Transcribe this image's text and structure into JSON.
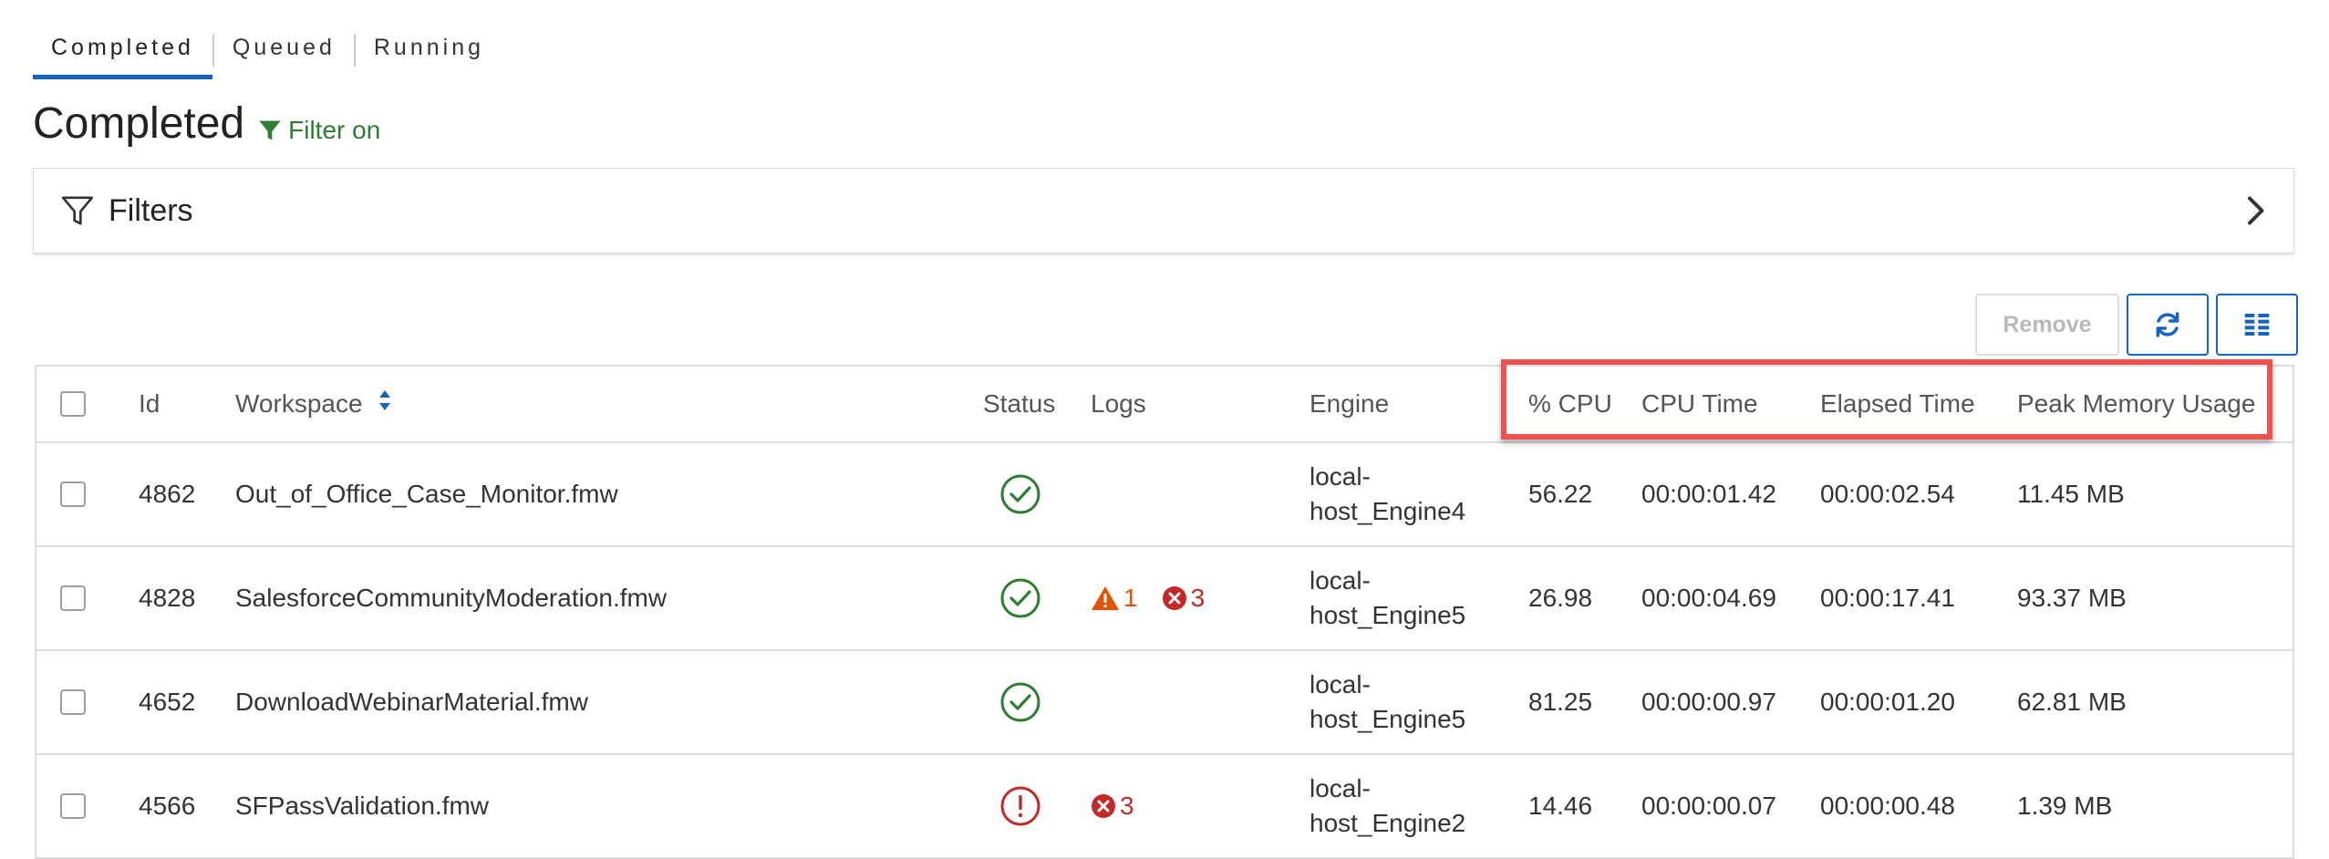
{
  "tabs": [
    {
      "label": "Completed",
      "active": true
    },
    {
      "label": "Queued",
      "active": false
    },
    {
      "label": "Running",
      "active": false
    }
  ],
  "page": {
    "title": "Completed",
    "filter_status": "Filter on"
  },
  "filters": {
    "label": "Filters"
  },
  "toolbar": {
    "remove_label": "Remove"
  },
  "table": {
    "headers": {
      "id": "Id",
      "workspace": "Workspace",
      "status": "Status",
      "logs": "Logs",
      "engine": "Engine",
      "cpu_percent": "% CPU",
      "cpu_time": "CPU Time",
      "elapsed_time": "Elapsed Time",
      "peak_memory": "Peak Memory Usage"
    },
    "rows": [
      {
        "id": "4862",
        "workspace": "Out_of_Office_Case_Monitor.fmw",
        "status": "success",
        "warnings": "",
        "errors": "",
        "engine_line1": "local-",
        "engine_line2": "host_Engine4",
        "cpu_percent": "56.22",
        "cpu_time": "00:00:01.42",
        "elapsed_time": "00:00:02.54",
        "peak_memory": "11.45 MB"
      },
      {
        "id": "4828",
        "workspace": "SalesforceCommunityModeration.fmw",
        "status": "success",
        "warnings": "1",
        "errors": "3",
        "engine_line1": "local-",
        "engine_line2": "host_Engine5",
        "cpu_percent": "26.98",
        "cpu_time": "00:00:04.69",
        "elapsed_time": "00:00:17.41",
        "peak_memory": "93.37 MB"
      },
      {
        "id": "4652",
        "workspace": "DownloadWebinarMaterial.fmw",
        "status": "success",
        "warnings": "",
        "errors": "",
        "engine_line1": "local-",
        "engine_line2": "host_Engine5",
        "cpu_percent": "81.25",
        "cpu_time": "00:00:00.97",
        "elapsed_time": "00:00:01.20",
        "peak_memory": "62.81 MB"
      },
      {
        "id": "4566",
        "workspace": "SFPassValidation.fmw",
        "status": "failure",
        "warnings": "",
        "errors": "3",
        "engine_line1": "local-",
        "engine_line2": "host_Engine2",
        "cpu_percent": "14.46",
        "cpu_time": "00:00:00.07",
        "elapsed_time": "00:00:00.48",
        "peak_memory": "1.39 MB"
      }
    ]
  },
  "colors": {
    "accent": "#1565c0",
    "success": "#2e7d32",
    "error": "#c62828",
    "warning": "#e65100",
    "highlight": "#ef5350"
  },
  "icons": {
    "filter_on": "funnel-filled-icon",
    "filters": "funnel-outline-icon",
    "expand": "chevron-right-icon",
    "refresh": "refresh-icon",
    "columns": "column-list-icon",
    "sort": "sort-icon",
    "status_success": "check-circle-icon",
    "status_failure": "exclamation-circle-icon",
    "log_warning": "warning-triangle-icon",
    "log_error": "error-x-circle-icon"
  }
}
